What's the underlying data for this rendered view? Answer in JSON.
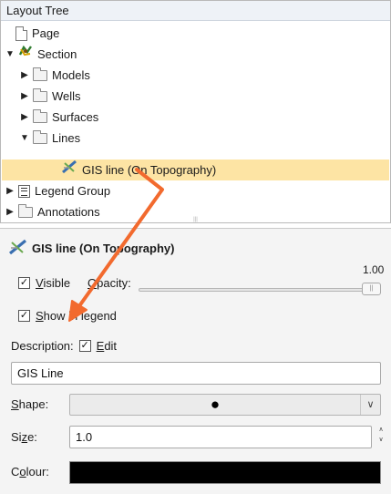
{
  "tree": {
    "header": "Layout Tree",
    "rows": [
      {
        "label": "Page",
        "arrow": "",
        "icon": "page-icon"
      },
      {
        "label": "Section",
        "arrow": "▼",
        "icon": "section-icon"
      },
      {
        "label": "Models",
        "arrow": "▶",
        "icon": "folder-icon"
      },
      {
        "label": "Wells",
        "arrow": "▶",
        "icon": "folder-icon"
      },
      {
        "label": "Surfaces",
        "arrow": "▶",
        "icon": "folder-icon"
      },
      {
        "label": "Lines",
        "arrow": "▼",
        "icon": "folder-icon"
      },
      {
        "label": "GIS line (On Topography)",
        "arrow": "",
        "icon": "gis-line-icon",
        "selected": true
      },
      {
        "label": "Legend Group",
        "arrow": "▶",
        "icon": "legend-icon"
      },
      {
        "label": "Annotations",
        "arrow": "▶",
        "icon": "folder-icon"
      }
    ]
  },
  "props": {
    "title": "GIS line (On Topography)",
    "visible": {
      "label_u": "V",
      "label_rest": "isible",
      "checked": "✓"
    },
    "opacity": {
      "label_u": "O",
      "label_rest": "pacity:",
      "value": "1.00",
      "level": 1.0
    },
    "show_in_legend": {
      "label_u": "S",
      "label_rest": "how in legend",
      "checked": "✓"
    },
    "description": {
      "label": "Description:",
      "edit_u": "E",
      "edit_rest": "dit",
      "checked": "✓",
      "value": "GIS Line"
    },
    "shape": {
      "label_u": "S",
      "label_rest": "hape:",
      "value": "●"
    },
    "size": {
      "label_u": "z",
      "label_pre": "Si",
      "label_rest": "e:",
      "value": "1.0"
    },
    "colour": {
      "label_pre": "C",
      "label_u": "o",
      "label_rest": "lour:",
      "value": "#000000"
    }
  },
  "colors": {
    "selection": "#fde4a4",
    "annotation_arrow": "#f26a2e"
  }
}
